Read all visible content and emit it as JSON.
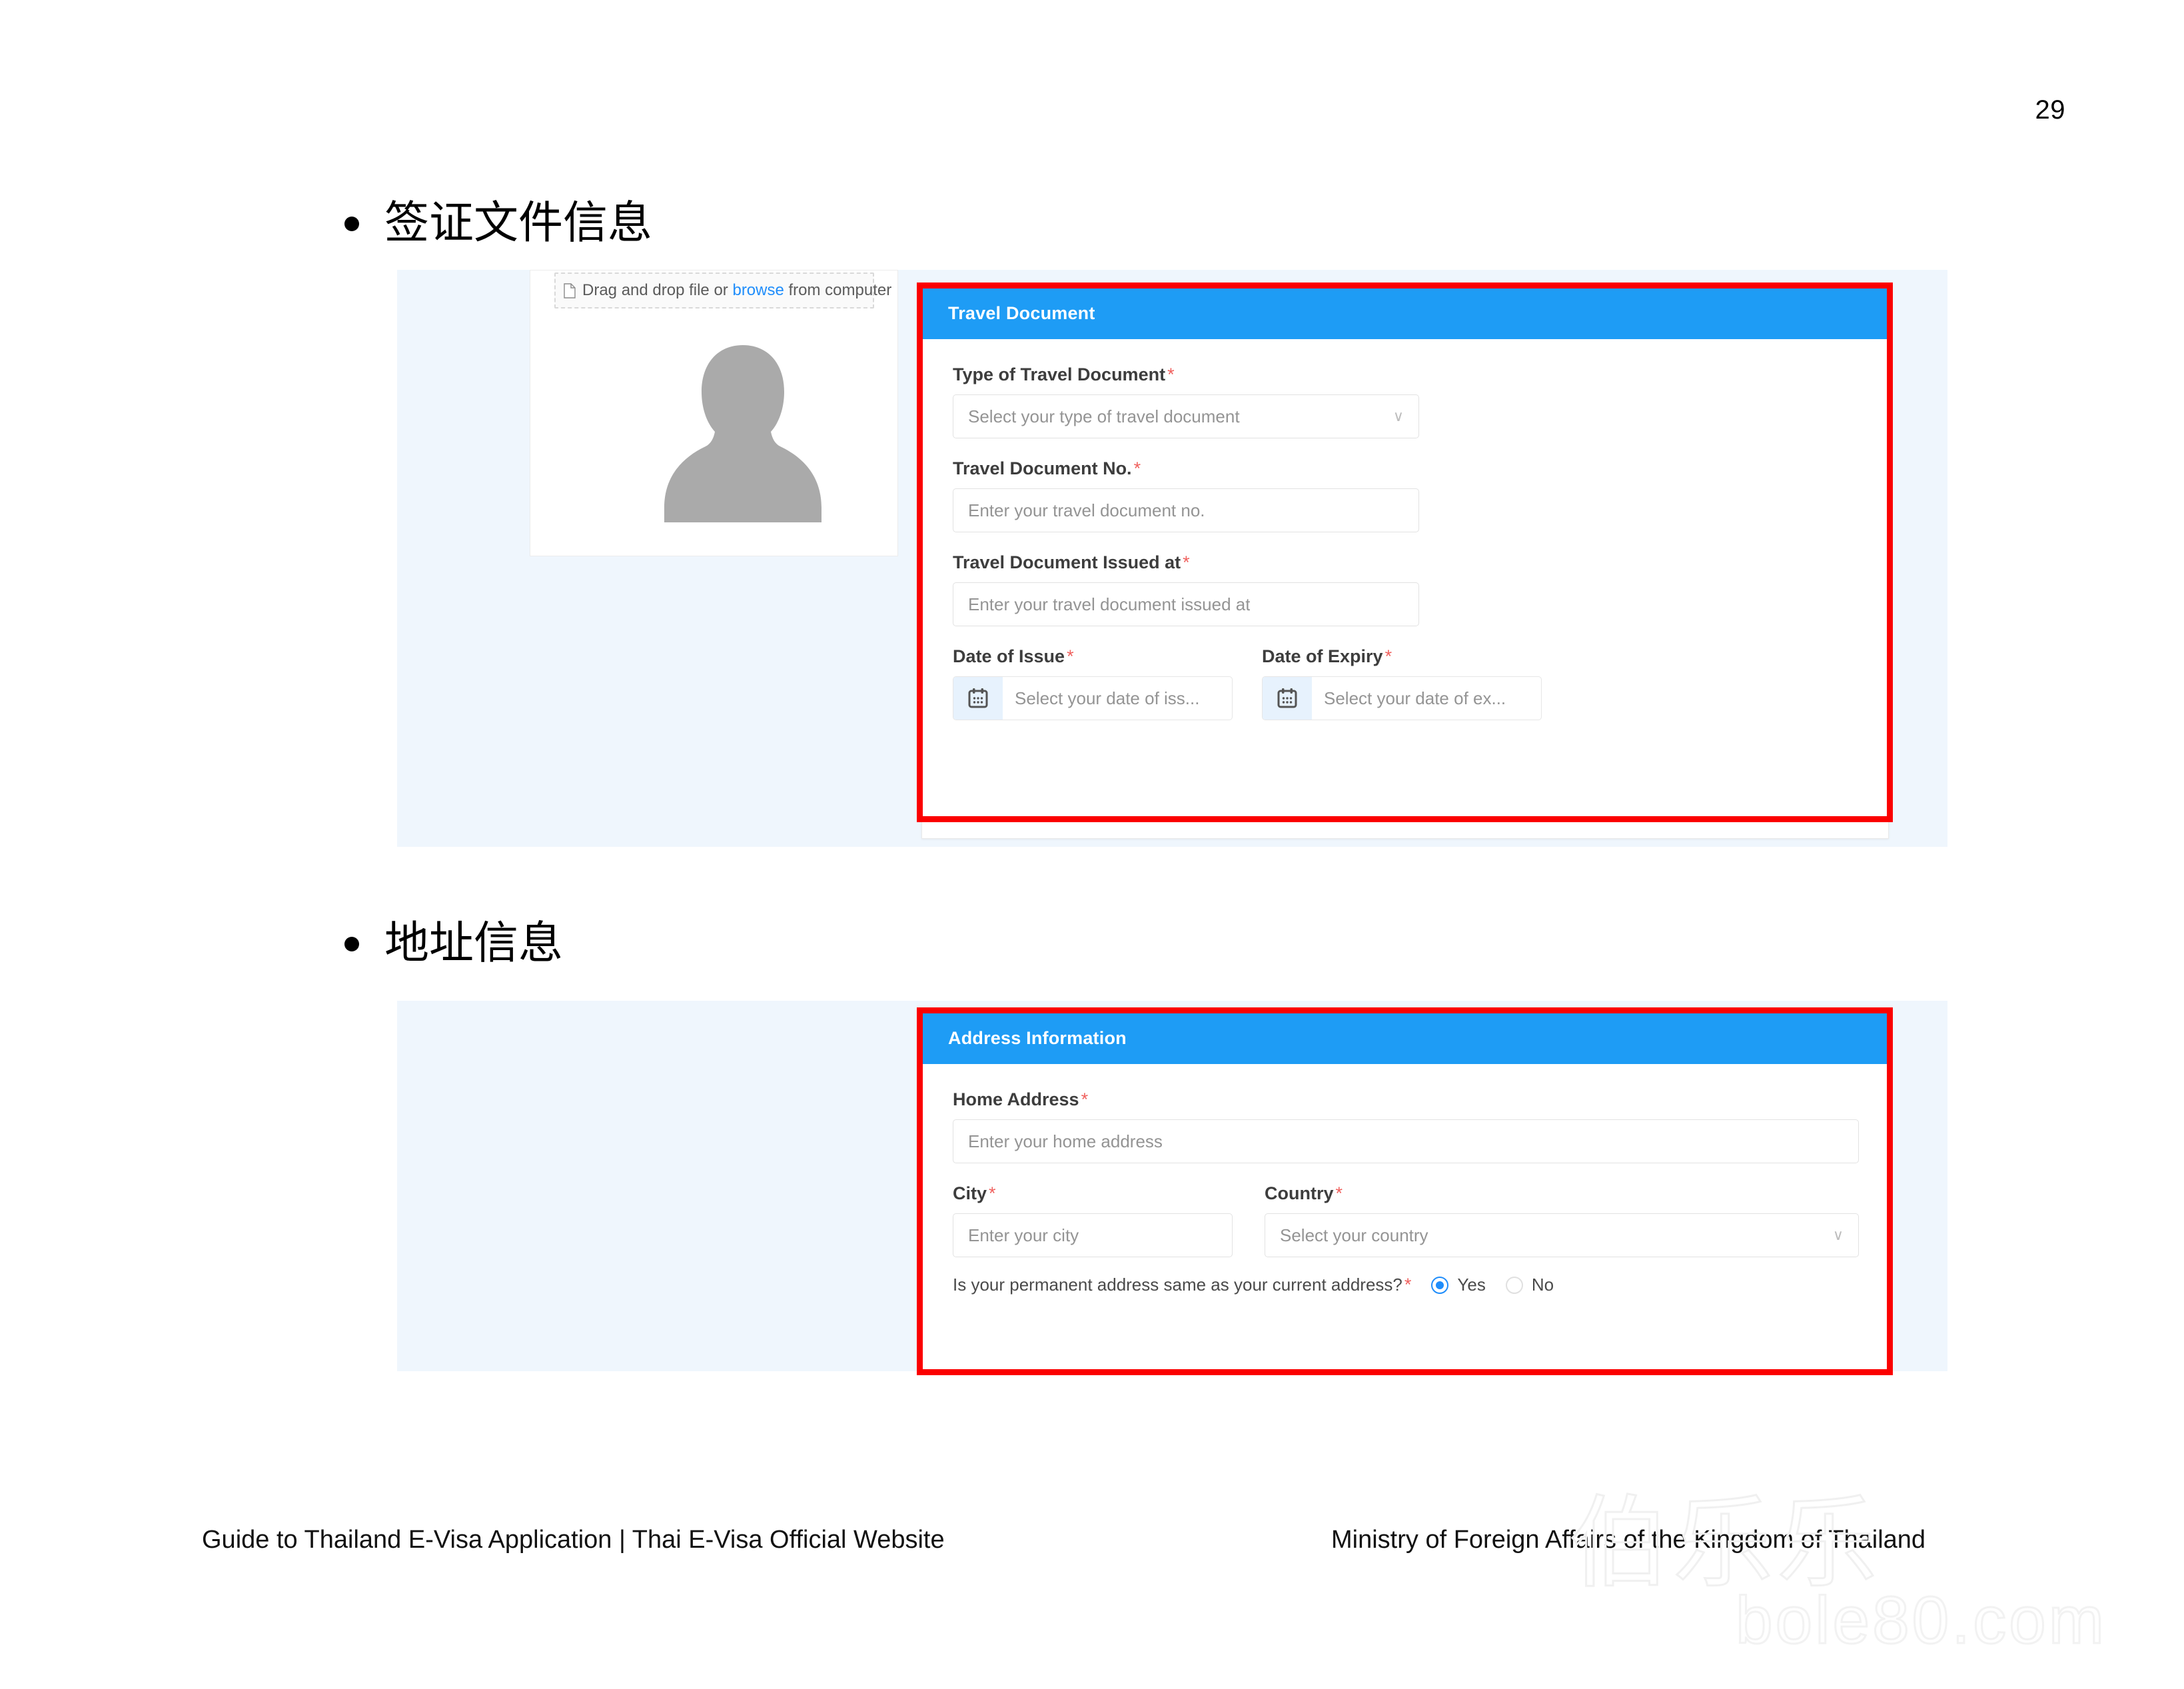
{
  "page": {
    "number": "29"
  },
  "sections": [
    {
      "bullet_label": "签证文件信息",
      "upload": {
        "drop_text_before": "Drag and drop file or ",
        "drop_link": "browse",
        "drop_text_after": " from computer",
        "file_icon": "file-icon",
        "avatar_icon": "person-placeholder-icon"
      },
      "card": {
        "title": "Travel Document",
        "fields": [
          {
            "label": "Type of Travel Document",
            "required": "*",
            "placeholder": "Select your type of travel document",
            "control": "select"
          },
          {
            "label": "Travel Document No.",
            "required": "*",
            "placeholder": "Enter your travel document no.",
            "control": "text"
          },
          {
            "label": "Travel Document Issued at",
            "required": "*",
            "placeholder": "Enter your travel document issued at",
            "control": "text"
          },
          {
            "label": "Date of Issue",
            "required": "*",
            "placeholder": "Select your date of iss...",
            "control": "date"
          },
          {
            "label": "Date of Expiry",
            "required": "*",
            "placeholder": "Select your date of ex...",
            "control": "date"
          }
        ]
      }
    },
    {
      "bullet_label": "地址信息",
      "card": {
        "title": "Address Information",
        "fields": [
          {
            "label": "Home Address",
            "required": "*",
            "placeholder": "Enter your home address",
            "control": "text"
          },
          {
            "label": "City",
            "required": "*",
            "placeholder": "Enter your city",
            "control": "text"
          },
          {
            "label": "Country",
            "required": "*",
            "placeholder": "Select your country",
            "control": "select"
          }
        ],
        "radio_group": {
          "question": "Is your permanent address same as your current address?",
          "required": "*",
          "options": [
            {
              "label": "Yes",
              "selected": true
            },
            {
              "label": "No",
              "selected": false
            }
          ]
        }
      }
    }
  ],
  "footer": {
    "left": "Guide to Thailand E-Visa Application | Thai E-Visa Official Website",
    "right": "Ministry of Foreign Affairs of the Kingdom of Thailand"
  },
  "watermark": {
    "cn": "伯乐乐",
    "en": "bole80.com"
  },
  "colors": {
    "header_blue": "#1e9cf5",
    "highlight_red": "#fb0000",
    "panel_bg": "#eff6fd",
    "link_blue": "#1f8dfb",
    "required_red": "#f0625f"
  }
}
